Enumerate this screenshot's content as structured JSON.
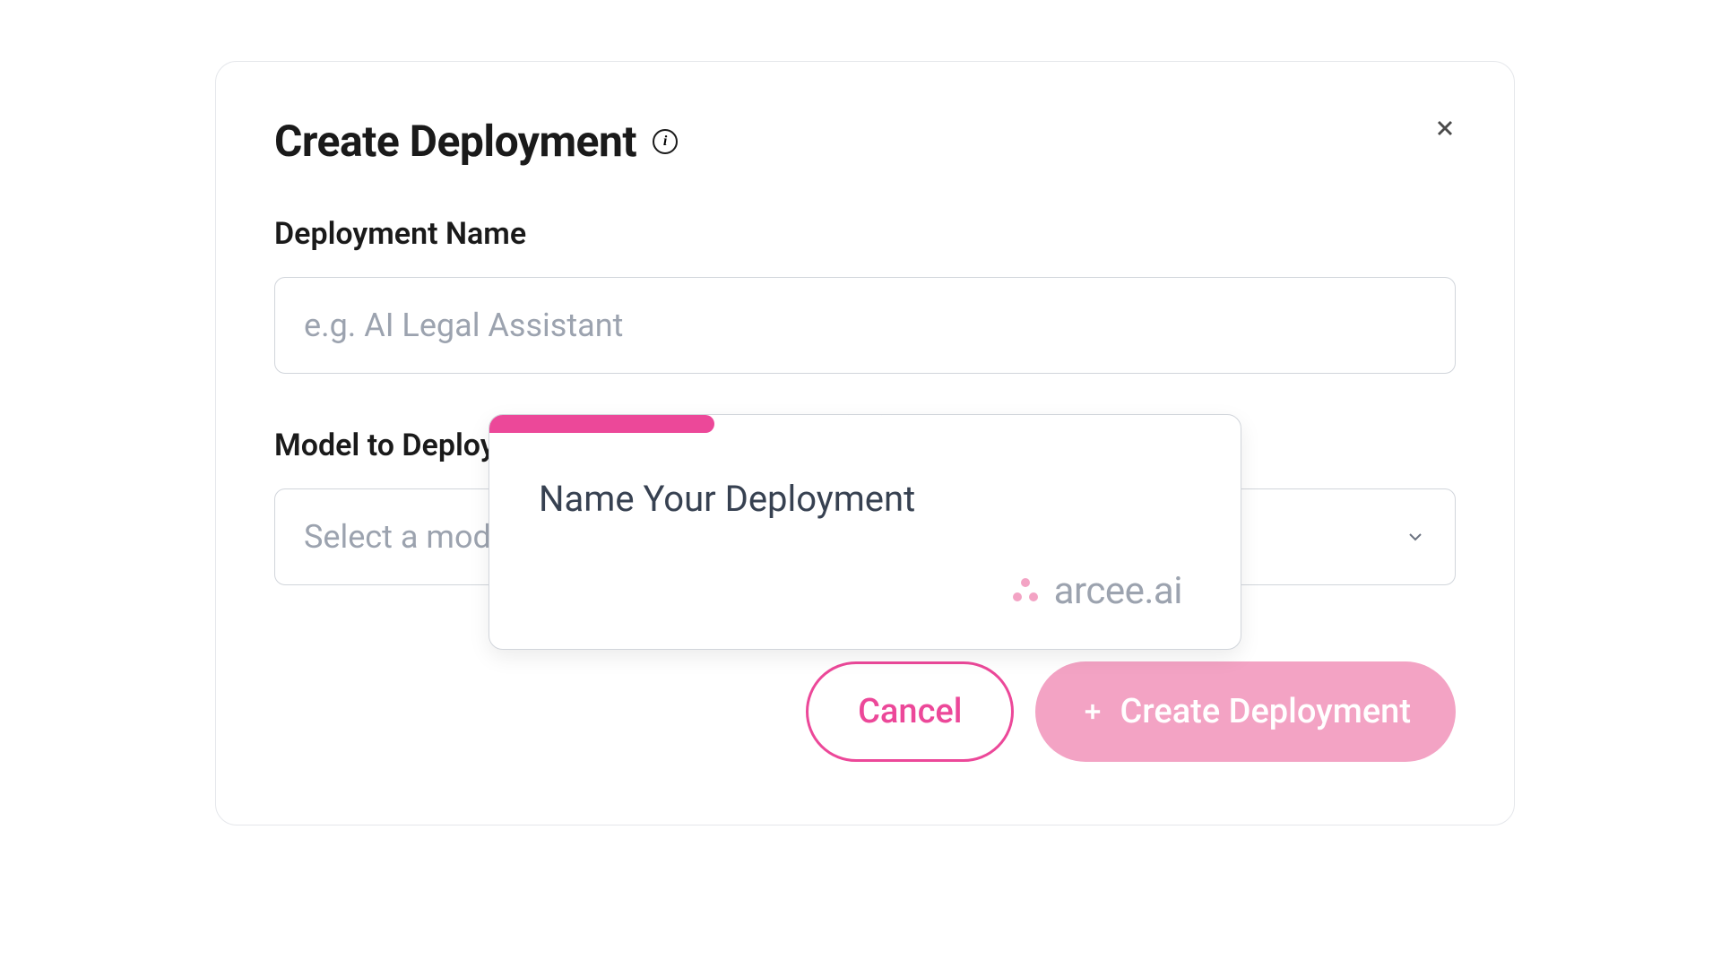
{
  "modal": {
    "title": "Create Deployment",
    "form": {
      "name_label": "Deployment Name",
      "name_placeholder": "e.g. AI Legal Assistant",
      "model_label": "Model to Deploy",
      "model_placeholder": "Select a model"
    },
    "buttons": {
      "cancel": "Cancel",
      "create": "Create Deployment"
    }
  },
  "tooltip": {
    "title": "Name Your Deployment",
    "brand": "arcee.ai"
  }
}
